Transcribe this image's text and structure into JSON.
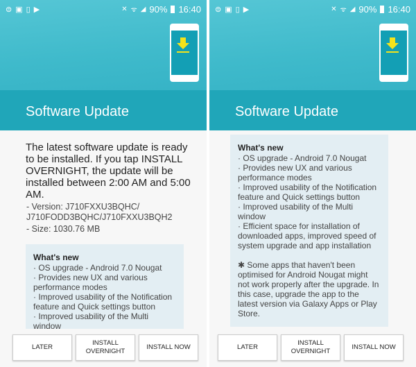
{
  "status": {
    "left_icons": [
      "notification-icon",
      "gallery-icon",
      "device-icon",
      "play-icon"
    ],
    "percent": "90%",
    "time": "16:40"
  },
  "title": "Software Update",
  "intro": "The latest software update is ready to be installed. If you tap INSTALL OVERNIGHT, the update will be installed between 2:00 AM and 5:00 AM.",
  "version": "- Version: J710FXXU3BQHC/ J710FODD3BQHC/J710FXXU3BQH2",
  "size": "- Size: 1030.76 MB",
  "whats_new": {
    "heading": "What's new",
    "items": [
      "· OS upgrade - Android 7.0 Nougat",
      "· Provides new UX and various performance modes",
      "· Improved usability of the Notification feature and Quick settings button",
      "· Improved usability of the Multi window",
      "· Efficient space for installation of downloaded apps, improved speed of system upgrade and app installation"
    ],
    "note": "✱ Some apps that haven't been optimised for Android Nougat might not work properly after the upgrade. In this case, upgrade the app to the latest version via Galaxy Apps or Play Store."
  },
  "buttons": {
    "later": "LATER",
    "overnight": "INSTALL\nOVERNIGHT",
    "now": "INSTALL NOW"
  },
  "colors": {
    "header": "#3fbacb",
    "band": "#20a6b9",
    "arrow": "#f5e31a"
  }
}
